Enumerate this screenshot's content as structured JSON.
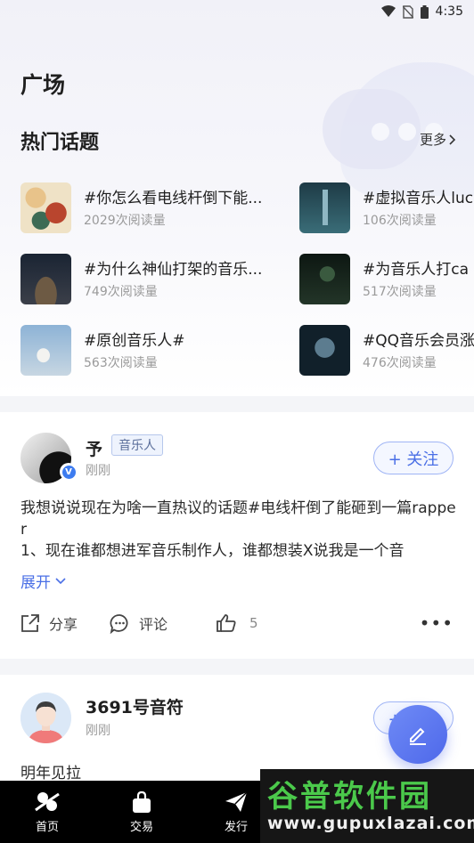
{
  "status_bar": {
    "time": "4:35"
  },
  "header": {
    "title": "广场"
  },
  "hot_topics": {
    "title": "热门话题",
    "more_label": "更多",
    "items": [
      {
        "name": "#你怎么看电线杆倒下能...",
        "reads": "2029次阅读量"
      },
      {
        "name": "#虚拟音乐人luc",
        "reads": "106次阅读量"
      },
      {
        "name": "#为什么神仙打架的音乐...",
        "reads": "749次阅读量"
      },
      {
        "name": "#为音乐人打ca",
        "reads": "517次阅读量"
      },
      {
        "name": "#原创音乐人#",
        "reads": "563次阅读量"
      },
      {
        "name": "#QQ音乐会员涨",
        "reads": "476次阅读量"
      }
    ]
  },
  "posts": [
    {
      "author": "予",
      "tag": "音乐人",
      "time": "刚刚",
      "follow_label": "+ 关注",
      "body": "我想说说现在为啥一直热议的话题#电线杆倒了能砸到一篇rapper\n1、现在谁都想进军音乐制作人，谁都想装X说我是一个音",
      "expand_label": "展开",
      "share_label": "分享",
      "comment_label": "评论",
      "like_count": "5"
    },
    {
      "author": "3691号音符",
      "time": "刚刚",
      "follow_label": "+ 关注",
      "body": "明年见拉"
    }
  ],
  "bottom_nav": {
    "items": [
      {
        "label": "首页",
        "icon": "home-icon"
      },
      {
        "label": "交易",
        "icon": "bag-icon"
      },
      {
        "label": "发行",
        "icon": "send-icon"
      }
    ]
  },
  "watermark": {
    "main": "谷普软件园",
    "url": "www.gupuxlazai.com"
  },
  "colors": {
    "accent": "#4a6fe6",
    "background": "#f4f5f8"
  }
}
